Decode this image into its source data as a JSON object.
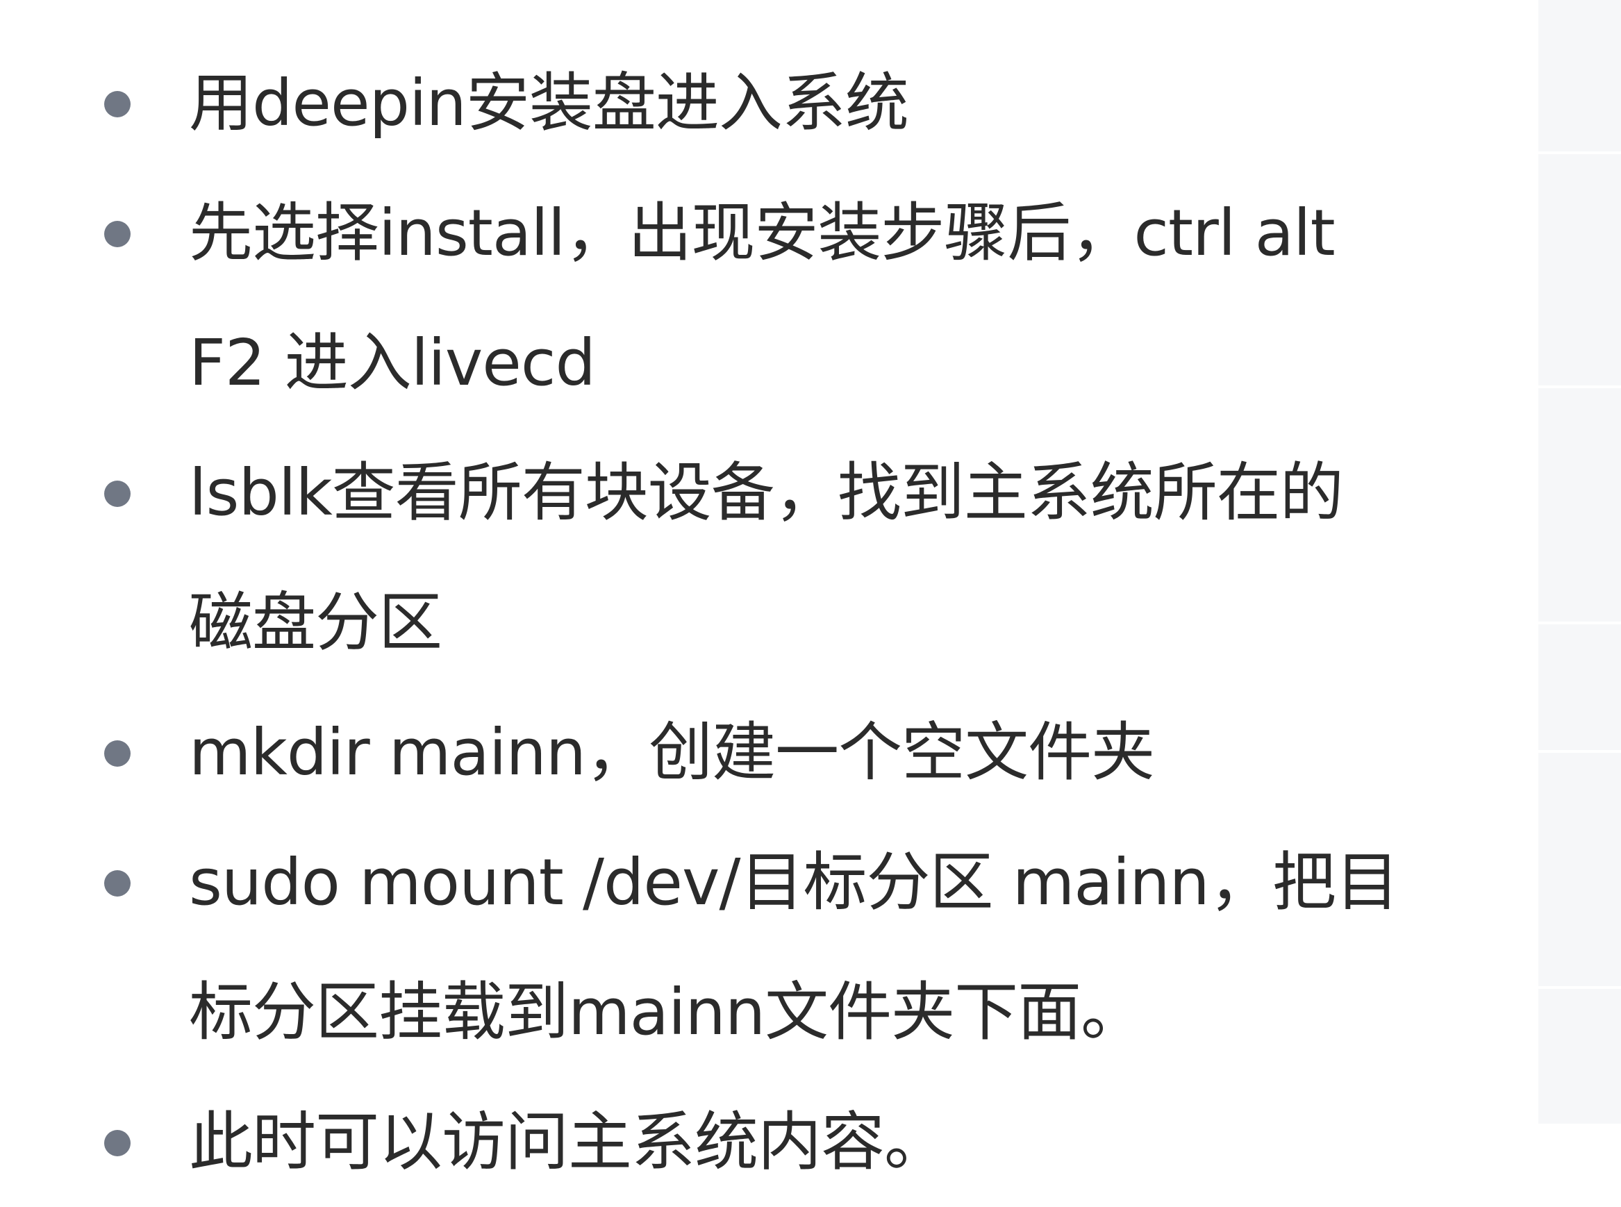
{
  "steps": [
    {
      "lines": [
        "用deepin安装盘进入系统"
      ]
    },
    {
      "lines": [
        "先选择install，出现安装步骤后，ctrl alt",
        "F2 进入livecd"
      ]
    },
    {
      "lines": [
        "lsblk查看所有块设备，找到主系统所在的",
        "磁盘分区"
      ]
    },
    {
      "lines": [
        "mkdir mainn，创建一个空文件夹"
      ]
    },
    {
      "lines": [
        "sudo mount /dev/目标分区 mainn，把目",
        "标分区挂载到mainn文件夹下面。"
      ]
    },
    {
      "lines": [
        "此时可以访问主系统内容。"
      ]
    }
  ],
  "colors": {
    "text": "#2b2b2b",
    "bullet": "#707784",
    "side_panel": "#f6f7f9"
  }
}
